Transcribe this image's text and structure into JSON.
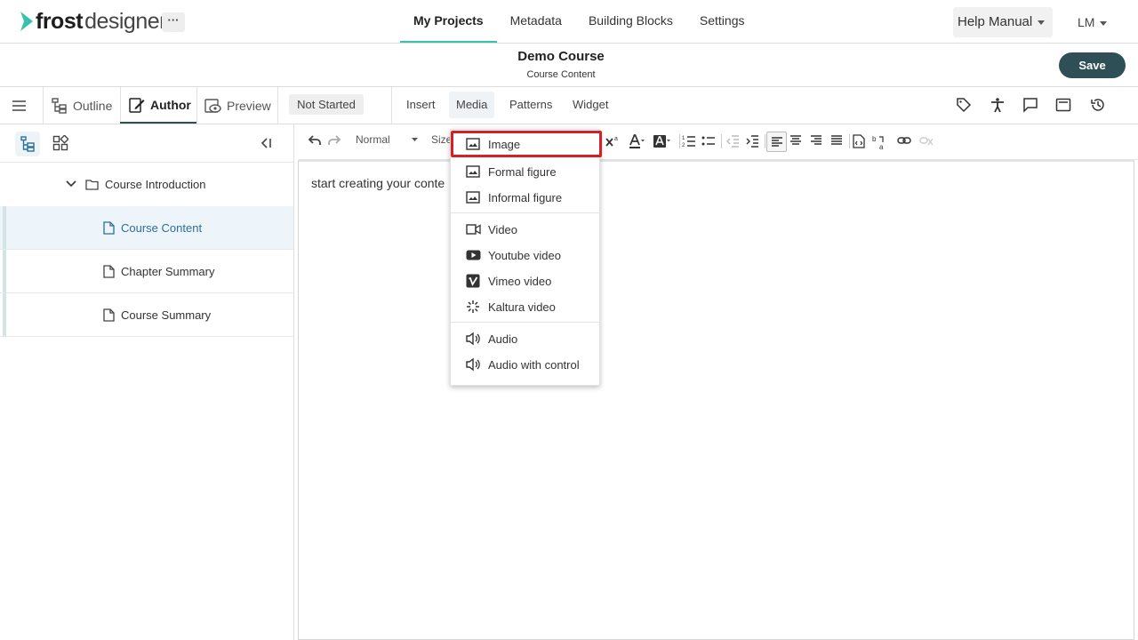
{
  "brand": {
    "word1": "frost",
    "word2": "designer",
    "more": "···"
  },
  "nav": {
    "links": [
      "My Projects",
      "Metadata",
      "Building Blocks",
      "Settings"
    ],
    "active": "My Projects"
  },
  "help": {
    "label": "Help Manual"
  },
  "user": {
    "initials": "LM"
  },
  "course": {
    "title": "Demo Course",
    "subtitle": "Course Content"
  },
  "save": {
    "label": "Save"
  },
  "modes": {
    "outline": "Outline",
    "author": "Author",
    "preview": "Preview",
    "active": "Author"
  },
  "status": {
    "label": "Not Started"
  },
  "menus": {
    "insert": "Insert",
    "media": "Media",
    "patterns": "Patterns",
    "widget": "Widget",
    "active": "Media"
  },
  "right_icons": [
    "tag-icon",
    "accessibility-icon",
    "comment-icon",
    "panel-icon",
    "history-icon"
  ],
  "tree": {
    "root": "Course Introduction",
    "children": [
      {
        "label": "Course Content",
        "selected": true
      },
      {
        "label": "Chapter Summary",
        "selected": false
      },
      {
        "label": "Course Summary",
        "selected": false
      }
    ]
  },
  "editor": {
    "format": "Normal",
    "size_label": "Size",
    "content": "start creating your conte"
  },
  "media_menu": {
    "groups": [
      [
        {
          "label": "Image",
          "icon": "image-icon",
          "highlighted": true
        },
        {
          "label": "Formal figure",
          "icon": "image-icon"
        },
        {
          "label": "Informal figure",
          "icon": "image-icon"
        }
      ],
      [
        {
          "label": "Video",
          "icon": "video-icon"
        },
        {
          "label": "Youtube video",
          "icon": "youtube-icon"
        },
        {
          "label": "Vimeo video",
          "icon": "vimeo-icon"
        },
        {
          "label": "Kaltura video",
          "icon": "kaltura-icon"
        }
      ],
      [
        {
          "label": "Audio",
          "icon": "audio-icon"
        },
        {
          "label": "Audio with control",
          "icon": "audio-icon"
        }
      ]
    ]
  },
  "colors": {
    "accent": "#36c2b0",
    "save_bg": "#2f4f56",
    "highlight": "#d81f26",
    "selected_text": "#2a6f99"
  }
}
